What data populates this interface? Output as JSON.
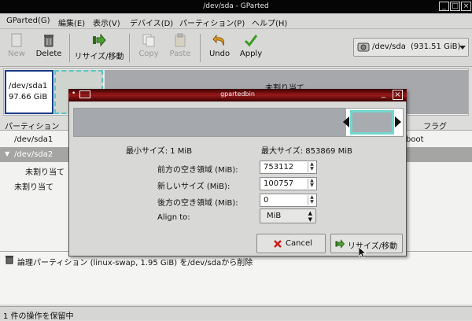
{
  "window": {
    "title": "/dev/sda - GParted"
  },
  "menubar": {
    "items": [
      {
        "label": "GParted(G)"
      },
      {
        "label": "編集(E)"
      },
      {
        "label": "表示(V)"
      },
      {
        "label": "デバイス(D)"
      },
      {
        "label": "パーティション(P)"
      },
      {
        "label": "ヘルプ(H)"
      }
    ]
  },
  "toolbar": {
    "new_label": "New",
    "delete_label": "Delete",
    "resize_label": "リサイズ/移動",
    "copy_label": "Copy",
    "paste_label": "Paste",
    "undo_label": "Undo",
    "apply_label": "Apply",
    "device": {
      "name": "/dev/sda",
      "size": "(931.51 GiB)"
    }
  },
  "diskmap": {
    "seg1_name": "/dev/sda1",
    "seg1_size": "97.66 GiB",
    "unalloc_label": "未割り当て"
  },
  "partition_list": {
    "header_partition": "パーティション",
    "header_flag": "フラグ",
    "rows": [
      {
        "name": "/dev/sda1",
        "flag": "boot"
      },
      {
        "name": "/dev/sda2"
      },
      {
        "name": "未割り当て"
      },
      {
        "name": "未割り当て"
      }
    ]
  },
  "dialog": {
    "title": "gpartedbin",
    "min_size_label": "最小サイズ: 1 MiB",
    "max_size_label": "最大サイズ: 853869 MiB",
    "free_before_label": "前方の空き領域 (MiB):",
    "free_before_value": "753112",
    "new_size_label": "新しいサイズ (MiB):",
    "new_size_value": "100757",
    "free_after_label": "後方の空き領域 (MiB):",
    "free_after_value": "0",
    "align_label": "Align to:",
    "align_value": "MiB",
    "cancel_label": "Cancel",
    "resize_label": "リサイズ/移動"
  },
  "pending": {
    "operation": "論理パーティション (linux-swap, 1.95 GiB) を/dev/sdaから削除"
  },
  "status": {
    "text": "1 件の操作を保留中"
  },
  "colors": {
    "partition_border": "#1a3a88",
    "selected_partition": "#5ac6c0",
    "unallocated": "#a6a8ac",
    "dialog_title": "#9a1a1a"
  }
}
